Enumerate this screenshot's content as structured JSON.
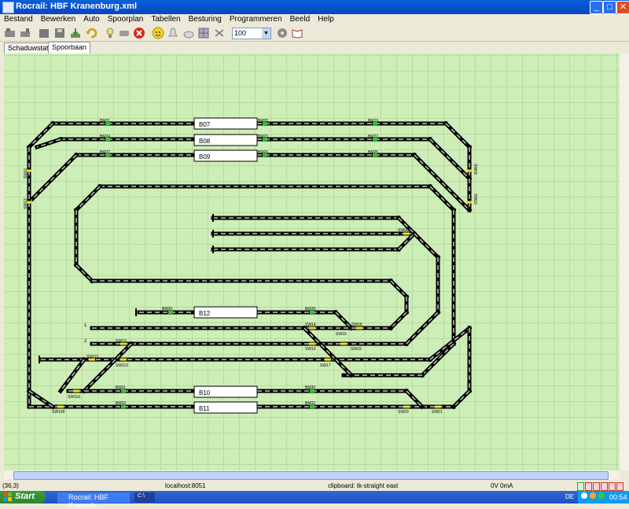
{
  "window": {
    "title": "Rocrail: HBF Kranenburg.xml"
  },
  "menu": [
    "Bestand",
    "Bewerken",
    "Auto",
    "Spoorplan",
    "Tabellen",
    "Besturing",
    "Programmeren",
    "Beeld",
    "Help"
  ],
  "toolbar": {
    "zoom_value": "100"
  },
  "tabs": [
    {
      "label": "Schaduwstation"
    },
    {
      "label": "Spoorbaan"
    }
  ],
  "blocks": [
    {
      "id": "B07"
    },
    {
      "id": "B08"
    },
    {
      "id": "B09"
    },
    {
      "id": "B12"
    },
    {
      "id": "B10"
    },
    {
      "id": "B11"
    }
  ],
  "sensors": [
    "BM21",
    "BM24",
    "BM27",
    "BM20",
    "BM23",
    "BM26",
    "BM19",
    "BM22",
    "BM25",
    "BM29",
    "BM28",
    "BM31",
    "BM33",
    "BM30",
    "BM32"
  ],
  "switches": [
    "SW11",
    "SW12",
    "SW09",
    "SW10",
    "SW08",
    "SW14",
    "SW18",
    "SW15",
    "SW13",
    "SW16",
    "SW19",
    "SW111",
    "SW112",
    "SW17",
    "SW110",
    "SW109",
    "SW20",
    "SW21"
  ],
  "track_labels": [
    "1",
    "2"
  ],
  "status": {
    "coords": "(36,3)",
    "host": "localhost:8051",
    "clipboard": "clipboard: tk-straight east",
    "power": "0V 0mA"
  },
  "taskbar": {
    "start_label": "Start",
    "items": [
      {
        "label": "Rocrail: HBF Kranenb..."
      },
      {
        "label": "C:\\"
      }
    ],
    "lang": "DE",
    "time": "00:54"
  }
}
